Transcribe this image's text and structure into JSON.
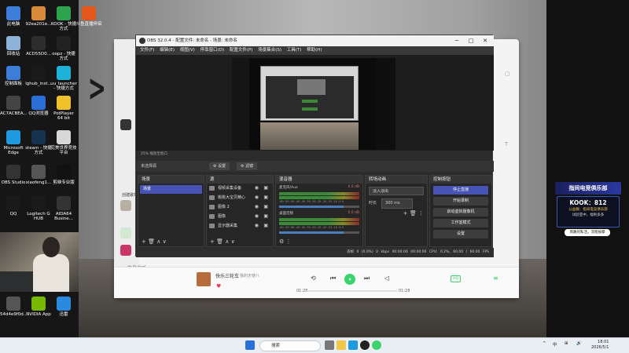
{
  "desktop": {
    "icons": [
      {
        "label": "此电脑",
        "color": "#3b7dd8"
      },
      {
        "label": "92ea201e...",
        "color": "#d88a3b"
      },
      {
        "label": "KOOK - 快捷方式",
        "color": "#2ea44f"
      },
      {
        "label": "斗鱼直播伴侣",
        "color": "#e5581b"
      },
      {
        "label": "回收站",
        "color": "#8fb3d8"
      },
      {
        "label": "ACD55D0...",
        "color": "#2d2d2d"
      },
      {
        "label": "oopz - 快捷方式",
        "color": "#222"
      },
      {
        "label": "控制面板",
        "color": "#3b7dd8"
      },
      {
        "label": "lghub_inst...",
        "color": "#1a1a1a"
      },
      {
        "label": "uu_launcher - 快捷方式",
        "color": "#1fb2d8"
      },
      {
        "label": "AC7ACBEA...",
        "color": "#444"
      },
      {
        "label": "QQ浏览器",
        "color": "#2a6fd8"
      },
      {
        "label": "PotPlayer 64 bit",
        "color": "#f0c02a"
      },
      {
        "label": "Microsoft Edge",
        "color": "#1e9be0"
      },
      {
        "label": "steam - 快捷方式",
        "color": "#17324f"
      },
      {
        "label": "完美世界竞技平台",
        "color": "#d8d8d8"
      },
      {
        "label": "OBS Studio",
        "color": "#333"
      },
      {
        "label": "xiaofeng1...",
        "color": "#555"
      },
      {
        "label": "剪映专业版",
        "color": "#111"
      },
      {
        "label": "QQ",
        "color": "#1a1a1a"
      },
      {
        "label": "Logitech G HUB",
        "color": "#1a1a1a"
      },
      {
        "label": "AIDA64 Busine...",
        "color": "#333"
      },
      {
        "label": "54d4e9f0d...",
        "color": "#555"
      },
      {
        "label": "NVIDIA App",
        "color": "#76b900"
      },
      {
        "label": "迅雷",
        "color": "#2a8ae0"
      }
    ]
  },
  "music": {
    "sidebar_texts": [
      "创建歌单",
      "我最爱听"
    ],
    "song": "快乐三轮车",
    "singer": "我的天使八",
    "time_current": "01:28",
    "time_total": "01:28",
    "quality_badge": "HQ",
    "icons": {
      "prev": "⏮",
      "play": "⏸",
      "next": "⏭",
      "like": "♥"
    }
  },
  "obs": {
    "title": "OBS 32.0.4 - 配置文件: 未命名 - 场景: 未命名",
    "window_controls": [
      "─",
      "□",
      "✕"
    ],
    "menu": [
      "文件(F)",
      "编辑(E)",
      "视图(V)",
      "停靠窗口(D)",
      "配置文件(P)",
      "场景集合(S)",
      "工具(T)",
      "帮助(H)"
    ],
    "zoom_text": "25%   缩放至窗口",
    "no_source": "未选择源",
    "props_button": "⚙ 设置",
    "filters_button": "⚙ 滤镜",
    "docks": {
      "scenes": {
        "title": "场景",
        "items": [
          "场景"
        ]
      },
      "sources": {
        "title": "源",
        "items": [
          "视频采集设备",
          "桃桃大宝贝精心",
          "图像 2",
          "图像",
          "显示器采集"
        ]
      },
      "mixer": {
        "title": "混音器",
        "channels": [
          {
            "name": "麦克风/Aux",
            "db": "0.0 dB"
          },
          {
            "name": "桌面音频",
            "db": "0.0 dB"
          }
        ]
      },
      "transitions": {
        "title": "转场动画",
        "selected": "淡入淡出",
        "duration_label": "时长",
        "duration": "300 ms"
      },
      "controls": {
        "title": "控制按钮",
        "buttons": [
          "停止直播",
          "开始录制",
          "启动虚拟摄像机",
          "工作室模式",
          "设置"
        ]
      }
    },
    "meter_ticks": "-60 -55 -50 -45 -40 -35 -30 -25 -20 -15 -10 -5 0",
    "footer": {
      "add": "+",
      "remove": "🗑",
      "up": "∧",
      "down": "∨"
    },
    "status": {
      "dropped": "丢帧 0 (0.0%)",
      "bitrate": "0 kbps",
      "live": "00:00:00",
      "rec": "00:00:00",
      "cpu": "CPU: 0.2%, 60.00 / 60.00 FPS"
    }
  },
  "stream_overlay": {
    "banner": "指间电竞俱乐部",
    "code": "KOOK：812",
    "line1": "公益群：指间电竞俱乐部",
    "line2": "试验室中，福利多多",
    "pill": "周路的私活，流程按摩"
  },
  "taskbar": {
    "search_placeholder": "搜索",
    "tray": [
      "^",
      "中",
      "⊞",
      "🔊"
    ],
    "time": "18:01",
    "date": "2026/5/1"
  },
  "colors": {
    "obs_accent": "#4753b5",
    "music_accent": "#3bd36b"
  }
}
